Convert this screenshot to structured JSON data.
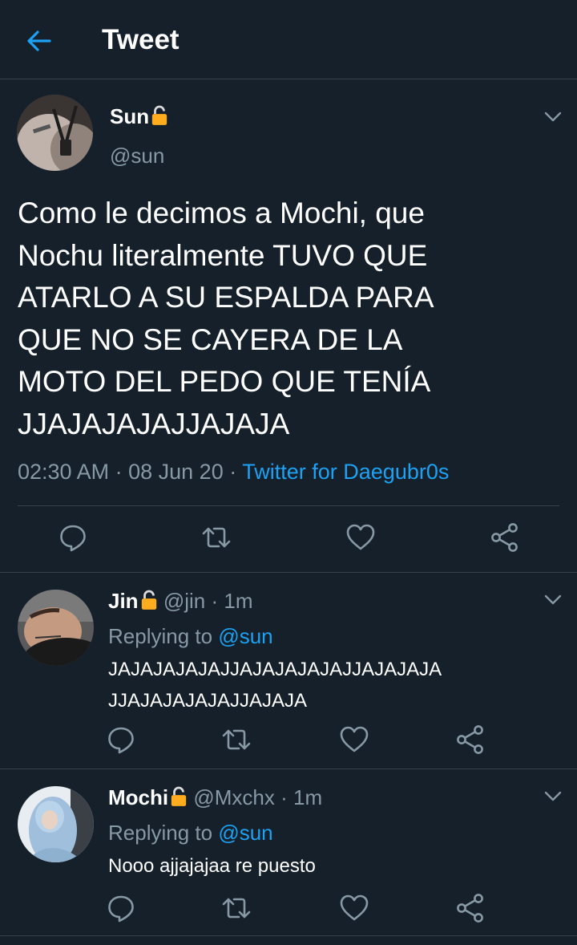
{
  "header": {
    "title": "Tweet"
  },
  "main_tweet": {
    "name": "Sun",
    "handle": "@sun",
    "text": "Como le decimos a Mochi, que\nNochu literalmente TUVO QUE\nATARLO A SU ESPALDA PARA\nQUE NO SE CAYERA DE LA\nMOTO DEL PEDO QUE TENÍA\nJJAJAJAJAJJAJAJA",
    "time": "02:30 AM",
    "date": "08 Jun 20",
    "source": "Twitter for Daegubr0s",
    "sep": "·"
  },
  "replies": [
    {
      "name": "Jin",
      "handle": "@jin",
      "time": "1m",
      "sep": "·",
      "replying_prefix": "Replying to",
      "replying_to": "@sun",
      "text": "JAJAJAJAJAJJAJAJAJAJAJJAJAJAJA\nJJAJAJAJAJAJJAJAJA"
    },
    {
      "name": "Mochi",
      "handle": "@Mxchx",
      "time": "1m",
      "sep": "·",
      "replying_prefix": "Replying to",
      "replying_to": "@sun",
      "text": "Nooo ajjajajaa re puesto"
    }
  ],
  "icons": {
    "back": "arrow-left-icon",
    "lock": "lock-icon",
    "menu": "chevron-down-icon",
    "reply": "reply-icon",
    "retweet": "retweet-icon",
    "like": "heart-icon",
    "share": "share-icon"
  },
  "colors": {
    "background": "#15202b",
    "accent": "#1da1f2",
    "muted": "#8899a6",
    "divider": "#38444d",
    "lock": "#ffad1f"
  }
}
